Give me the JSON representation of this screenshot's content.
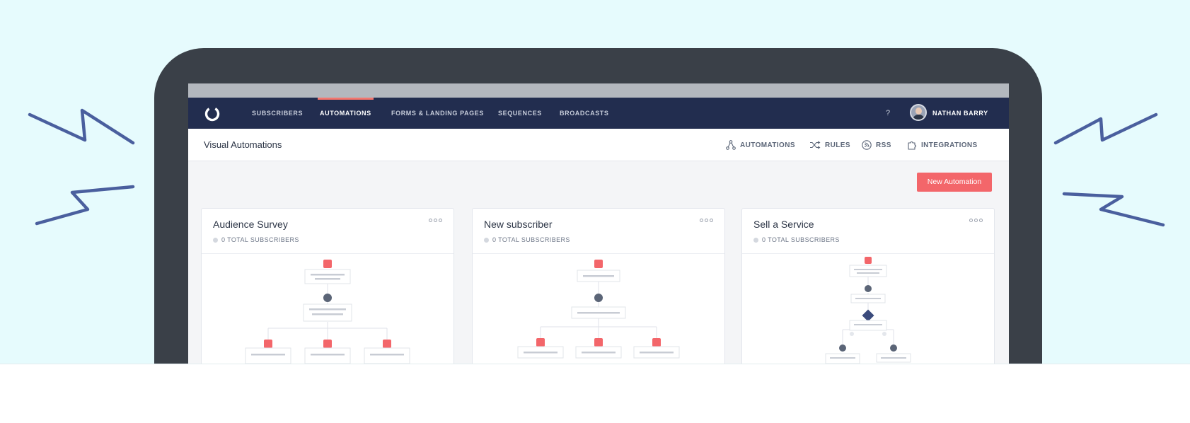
{
  "nav": {
    "items": [
      {
        "label": "SUBSCRIBERS",
        "active": false
      },
      {
        "label": "AUTOMATIONS",
        "active": true
      },
      {
        "label": "FORMS & LANDING PAGES",
        "active": false
      },
      {
        "label": "SEQUENCES",
        "active": false
      },
      {
        "label": "BROADCASTS",
        "active": false
      }
    ],
    "help": "?",
    "user_name": "NATHAN BARRY"
  },
  "subheader": {
    "title": "Visual Automations",
    "links": [
      {
        "label": "AUTOMATIONS",
        "icon": "automation-tree-icon"
      },
      {
        "label": "RULES",
        "icon": "shuffle-icon"
      },
      {
        "label": "RSS",
        "icon": "rss-icon"
      },
      {
        "label": "INTEGRATIONS",
        "icon": "puzzle-icon"
      }
    ]
  },
  "new_automation_label": "New Automation",
  "cards": [
    {
      "title": "Audience Survey",
      "meta": "0 TOTAL SUBSCRIBERS"
    },
    {
      "title": "New subscriber",
      "meta": "0 TOTAL SUBSCRIBERS"
    },
    {
      "title": "Sell a Service",
      "meta": "0 TOTAL SUBSCRIBERS"
    }
  ],
  "colors": {
    "background": "#e6fbfd",
    "laptop": "#3a4048",
    "nav": "#222d4f",
    "accent": "#f3666a",
    "zigzag": "#4a5f9e"
  }
}
